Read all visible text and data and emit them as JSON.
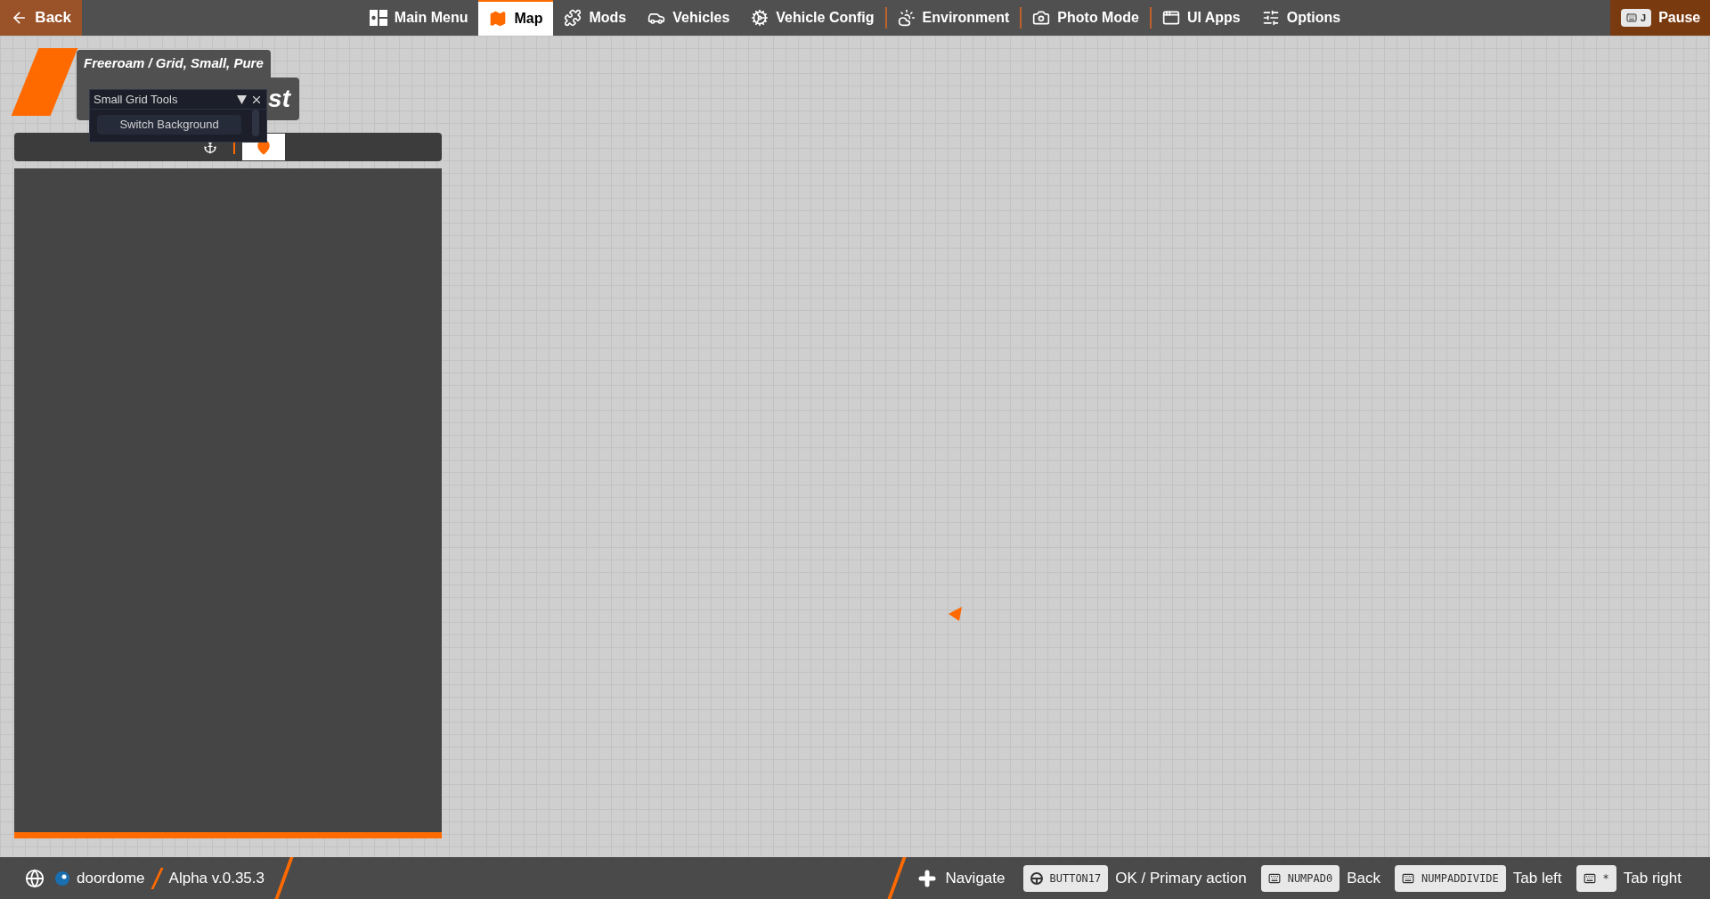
{
  "top_bar": {
    "back": "Back",
    "tabs": [
      {
        "label": "Main Menu",
        "selected": false,
        "divider_before": false
      },
      {
        "label": "Map",
        "selected": true,
        "divider_before": false
      },
      {
        "label": "Mods",
        "selected": false,
        "divider_before": false
      },
      {
        "label": "Vehicles",
        "selected": false,
        "divider_before": false
      },
      {
        "label": "Vehicle Config",
        "selected": false,
        "divider_before": false
      },
      {
        "label": "Environment",
        "selected": false,
        "divider_before": true
      },
      {
        "label": "Photo Mode",
        "selected": false,
        "divider_before": true
      },
      {
        "label": "UI Apps",
        "selected": false,
        "divider_before": true
      },
      {
        "label": "Options",
        "selected": false,
        "divider_before": false
      }
    ],
    "pause_key": "J",
    "pause": "Pause"
  },
  "breadcrumb": "Freeroam / Grid, Small, Pure",
  "title": "st",
  "tool_window": {
    "title": "Small Grid Tools",
    "buttons": [
      "Switch Background"
    ]
  },
  "panel_tabs": [
    {
      "selected": false
    },
    {
      "selected": true
    }
  ],
  "status_bar": {
    "user": "doordome",
    "version": "Alpha v.0.35.3",
    "navigate": "Navigate",
    "hints": [
      {
        "key": "BUTTON17",
        "action": "OK / Primary action"
      },
      {
        "key": "NUMPAD0",
        "action": "Back"
      },
      {
        "key": "NUMPADDIVIDE",
        "action": "Tab left"
      },
      {
        "key": "*",
        "action": "Tab right"
      }
    ]
  }
}
